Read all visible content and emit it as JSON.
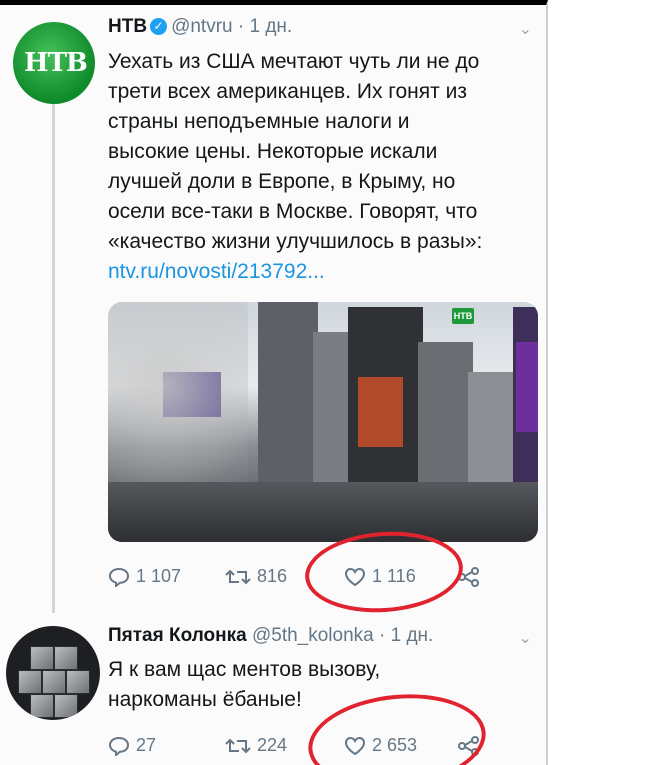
{
  "tweet1": {
    "avatar_label": "НТВ",
    "name": "НТВ",
    "handle": "@ntvru",
    "time": "1 дн.",
    "lines": [
      "Уехать из США мечтают чуть ли не до",
      "трети всех американцев. Их гонят из",
      "страны неподъемные налоги и",
      "высокие цены. Некоторые искали",
      "лучшей доли в Европе, в Крыму, но",
      "осели все-таки в Москве. Говорят, что",
      "«качество жизни улучшилось в разы»:"
    ],
    "link": "ntv.ru/novosti/213792...",
    "media_badge": "НТВ",
    "replies": "1 107",
    "retweets": "816",
    "likes": "1 116"
  },
  "tweet2": {
    "name": "Пятая Колонка",
    "handle": "@5th_kolonka",
    "time": "1 дн.",
    "lines": [
      "Я к вам щас ментов вызову,",
      "наркоманы ёбаные!"
    ],
    "replies": "27",
    "retweets": "224",
    "likes": "2 653"
  },
  "colors": {
    "accent": "#1b95e0",
    "verified": "#1da1f2",
    "annotation": "#e0232e",
    "ntv_green": "#1e9a3a"
  },
  "icons": [
    "verified-icon",
    "chevron-down-icon",
    "reply-icon",
    "retweet-icon",
    "like-icon",
    "share-icon"
  ]
}
